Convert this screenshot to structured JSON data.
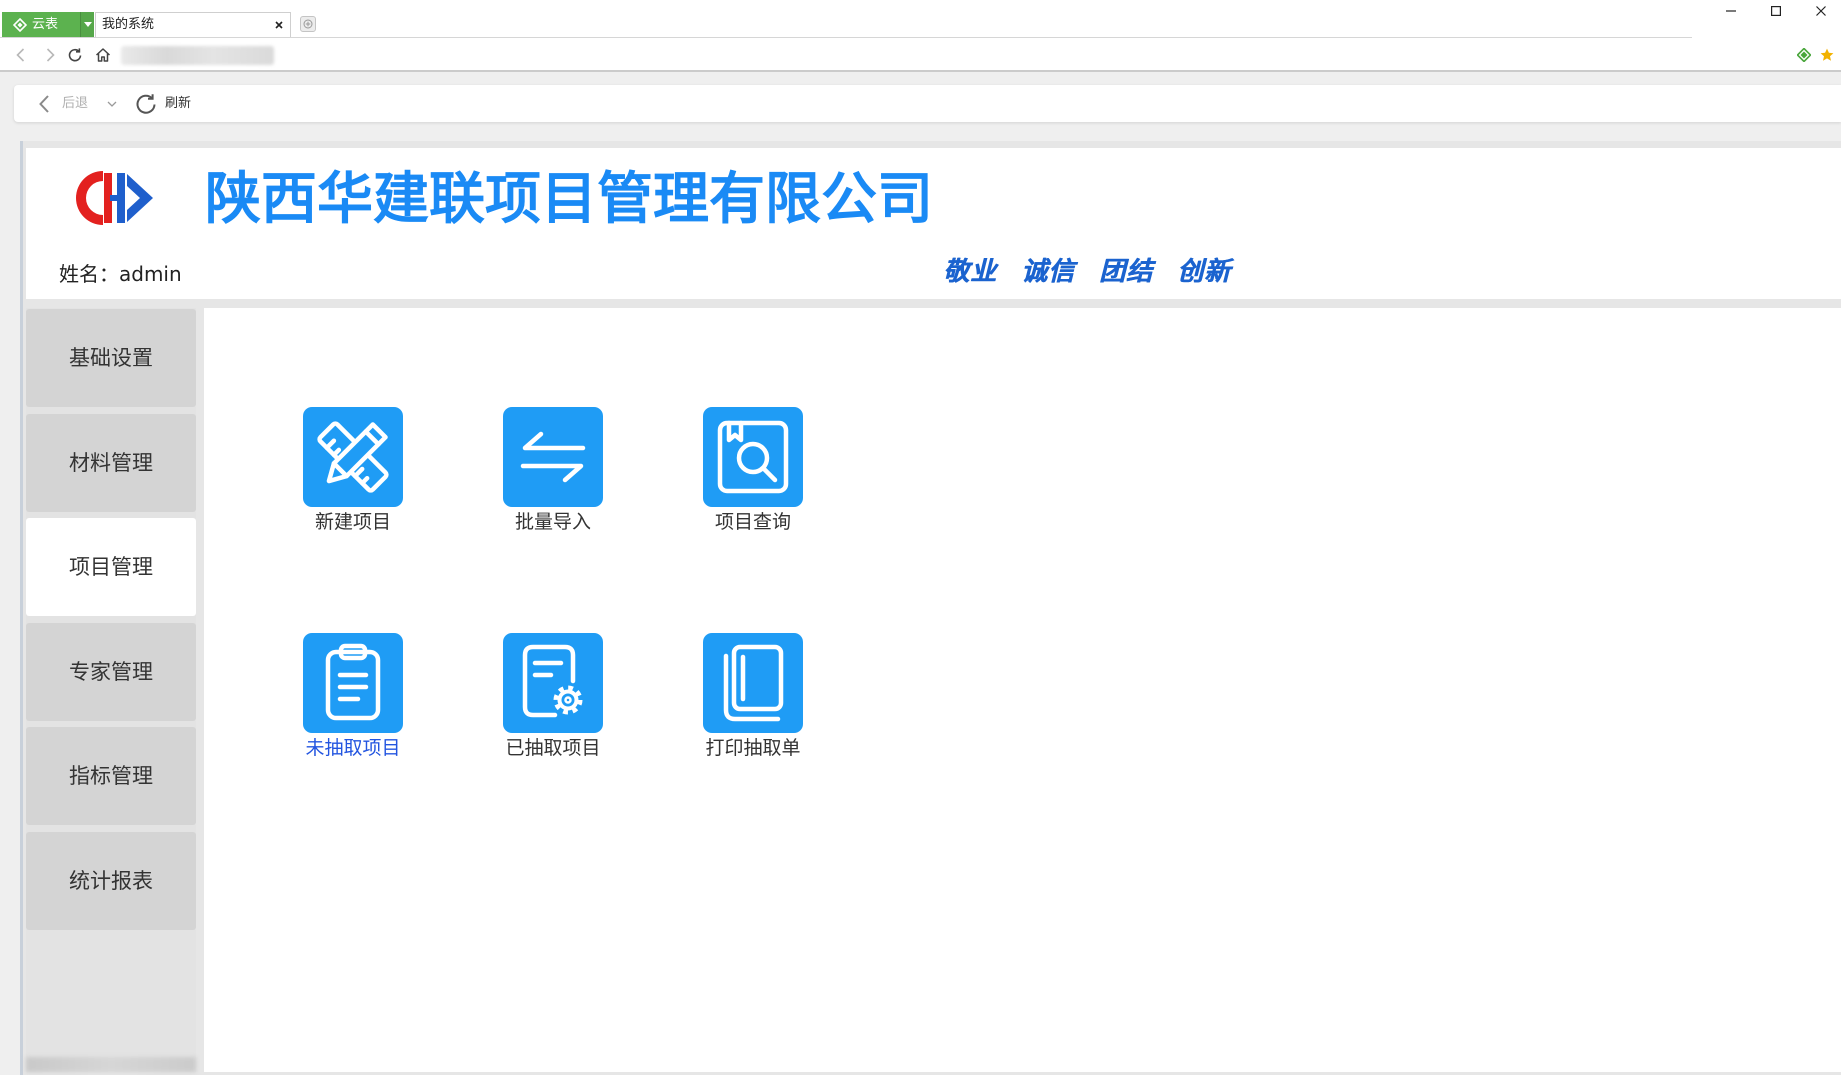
{
  "browser": {
    "app_menu": {
      "label": "云表",
      "icon": "yunbiao-logo-icon",
      "dropdown_icon": "caret-down-icon"
    },
    "tabs": [
      {
        "label": "我的系统",
        "active": true,
        "close_icon": "close-icon"
      }
    ],
    "new_tab_icon": "plus-icon",
    "window_controls": [
      "minimize-icon",
      "maximize-icon",
      "close-icon"
    ],
    "nav_icons": [
      "back-icon",
      "forward-icon",
      "reload-icon",
      "home-icon"
    ],
    "extension_icons": [
      "yunbiao-extension-icon",
      "favorite-star-icon"
    ]
  },
  "toolbar": {
    "back": {
      "label": "后退",
      "icon": "chevron-left-icon",
      "disabled": true
    },
    "history_icon": "chevron-down-icon",
    "refresh": {
      "label": "刷新",
      "icon": "refresh-icon"
    }
  },
  "header": {
    "logo": "company-logo",
    "title": "陕西华建联项目管理有限公司",
    "user": "姓名：admin",
    "slogan": [
      "敬业",
      "诚信",
      "团结",
      "创新"
    ]
  },
  "sidebar": {
    "items": [
      {
        "label": "基础设置",
        "active": false
      },
      {
        "label": "材料管理",
        "active": false
      },
      {
        "label": "项目管理",
        "active": true
      },
      {
        "label": "专家管理",
        "active": false
      },
      {
        "label": "指标管理",
        "active": false
      },
      {
        "label": "统计报表",
        "active": false
      }
    ]
  },
  "tiles": [
    {
      "label": "新建项目",
      "icon": "pencil-ruler-icon",
      "highlighted": false
    },
    {
      "label": "批量导入",
      "icon": "swap-arrows-icon",
      "highlighted": false
    },
    {
      "label": "项目查询",
      "icon": "document-search-icon",
      "highlighted": false
    },
    {
      "label": "未抽取项目",
      "icon": "clipboard-icon",
      "highlighted": true
    },
    {
      "label": "已抽取项目",
      "icon": "document-gear-icon",
      "highlighted": false
    },
    {
      "label": "打印抽取单",
      "icon": "book-icon",
      "highlighted": false
    }
  ],
  "colors": {
    "brand_blue": "#1a8af5",
    "slogan_blue": "#1b63cf",
    "tile_blue": "#1f9cf5",
    "link_blue": "#2355e0",
    "app_green": "#5cb24f",
    "logo_red": "#e3211f",
    "logo_blue": "#1f5fcc",
    "sidebar_item": "#d4d4d4",
    "sidebar_active": "#ffffff"
  }
}
